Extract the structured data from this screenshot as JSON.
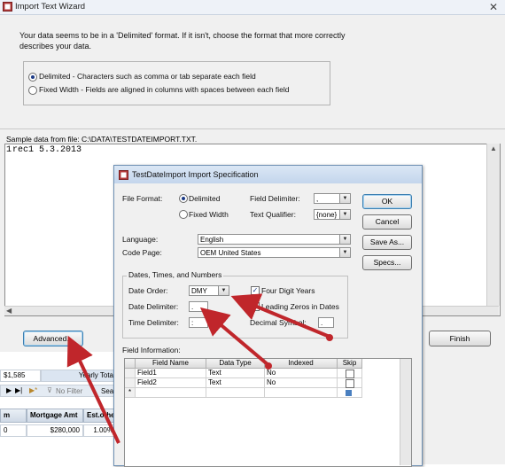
{
  "wizard": {
    "title": "Import Text Wizard",
    "intro": "Your data seems to be in a 'Delimited' format. If it isn't, choose the format that more correctly describes your data.",
    "options": [
      {
        "label": "Delimited - Characters such as comma or tab separate each field",
        "selected": true
      },
      {
        "label": "Fixed Width - Fields are aligned in columns with spaces between each field",
        "selected": false
      }
    ],
    "sample_label": "Sample data from file: C:\\DATA\\TESTDATEIMPORT.TXT.",
    "sample_line_number": "1",
    "sample_line_text": "rec1 5.3.2013",
    "advanced_button": "Advanced...",
    "finish_button": "Finish"
  },
  "background": {
    "row1": [
      "$1,585",
      "Yearly Tota"
    ],
    "filter_label": "No Filter",
    "search_label": "Sea",
    "headers": [
      "m",
      "Mortgage Amt",
      "Est.other"
    ],
    "row2": [
      "0",
      "$280,000",
      "1.00%"
    ]
  },
  "spec": {
    "title": "TestDateImport Import Specification",
    "file_format_label": "File Format:",
    "format_options": [
      {
        "label": "Delimited",
        "selected": true
      },
      {
        "label": "Fixed Width",
        "selected": false
      }
    ],
    "field_delimiter_label": "Field Delimiter:",
    "field_delimiter_value": ",",
    "text_qualifier_label": "Text Qualifier:",
    "text_qualifier_value": "{none}",
    "ok_button": "OK",
    "cancel_button": "Cancel",
    "save_as_button": "Save As...",
    "specs_button": "Specs...",
    "language_label": "Language:",
    "language_value": "English",
    "code_page_label": "Code Page:",
    "code_page_value": "OEM United States",
    "dtn_group_label": "Dates, Times, and Numbers",
    "date_order_label": "Date Order:",
    "date_order_value": "DMY",
    "four_digit_years_label": "Four Digit Years",
    "four_digit_years_checked": true,
    "date_delimiter_label": "Date Delimiter:",
    "date_delimiter_value": ".",
    "leading_zeros_label": "Leading Zeros in Dates",
    "leading_zeros_checked": false,
    "time_delimiter_label": "Time Delimiter:",
    "time_delimiter_value": ":",
    "decimal_symbol_label": "Decimal Symbol:",
    "decimal_symbol_value": ".",
    "field_info_label": "Field Information:",
    "grid_headers": [
      "Field Name",
      "Data Type",
      "Indexed",
      "Skip"
    ],
    "grid_rows": [
      {
        "name": "Field1",
        "type": "Text",
        "indexed": "No"
      },
      {
        "name": "Field2",
        "type": "Text",
        "indexed": "No"
      }
    ],
    "new_row_marker": "*"
  },
  "colors": {
    "arrow": "#c0262b",
    "window_bg": "#f0f0f0"
  }
}
